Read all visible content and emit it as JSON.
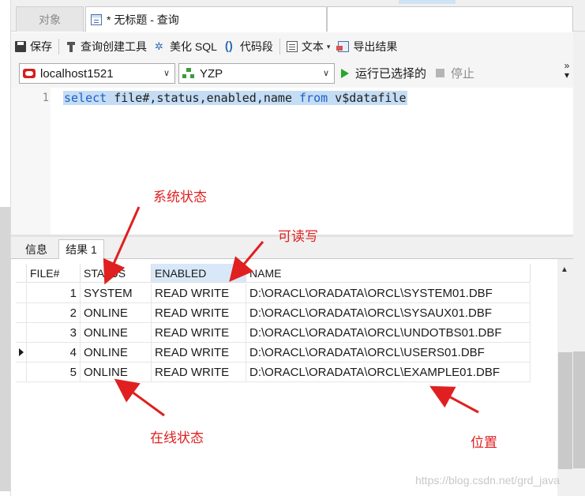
{
  "tabs": {
    "objects_label": "对象",
    "query_label": "* 无标题 - 查询"
  },
  "toolbar": {
    "save_label": "保存",
    "query_builder_label": "查询创建工具",
    "beautify_sql_label": "美化 SQL",
    "snippet_label": "代码段",
    "text_label": "文本",
    "export_label": "导出结果"
  },
  "connection": {
    "connection_value": "localhost1521",
    "schema_value": "YZP",
    "run_selected_label": "运行已选择的",
    "stop_label": "停止"
  },
  "editor": {
    "line_number": "1",
    "sql_parts": {
      "kw_select": "select",
      "cols": " file#,status,enabled,name ",
      "kw_from": "from",
      "table": " v$datafile"
    }
  },
  "result_tabs": {
    "info_label": "信息",
    "result_label": "结果 1"
  },
  "grid": {
    "columns": [
      "FILE#",
      "STATUS",
      "ENABLED",
      "NAME"
    ],
    "active_column": "ENABLED",
    "current_row_index": 3,
    "rows": [
      [
        "1",
        "SYSTEM",
        "READ WRITE",
        "D:\\ORACL\\ORADATA\\ORCL\\SYSTEM01.DBF"
      ],
      [
        "2",
        "ONLINE",
        "READ WRITE",
        "D:\\ORACL\\ORADATA\\ORCL\\SYSAUX01.DBF"
      ],
      [
        "3",
        "ONLINE",
        "READ WRITE",
        "D:\\ORACL\\ORADATA\\ORCL\\UNDOTBS01.DBF"
      ],
      [
        "4",
        "ONLINE",
        "READ WRITE",
        "D:\\ORACL\\ORADATA\\ORCL\\USERS01.DBF"
      ],
      [
        "5",
        "ONLINE",
        "READ WRITE",
        "D:\\ORACL\\ORADATA\\ORCL\\EXAMPLE01.DBF"
      ]
    ]
  },
  "annotations": {
    "system_status": "系统状态",
    "read_write": "可读写",
    "online_status": "在线状态",
    "location": "位置",
    "color": "#e02020"
  },
  "watermark": "https://blog.csdn.net/grd_java",
  "icons": {
    "save": "save-icon",
    "builder": "query-builder-icon",
    "beautify": "beautify-icon",
    "snippet": "snippet-icon",
    "text": "text-icon",
    "export": "export-icon",
    "connection": "oracle-connection-icon",
    "schema": "schema-icon",
    "run": "run-icon",
    "stop": "stop-icon"
  }
}
